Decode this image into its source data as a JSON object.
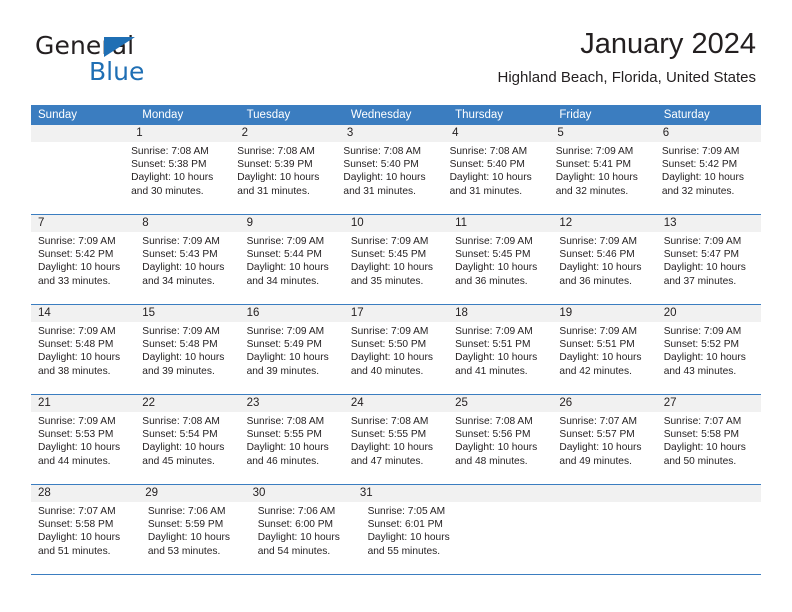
{
  "brand": {
    "name_part1": "General",
    "name_part2": "Blue",
    "accent_color": "#1f6fb4"
  },
  "header": {
    "title": "January 2024",
    "subtitle": "Highland Beach, Florida, United States",
    "header_bg_color": "#3b7dc0",
    "daynum_bg_color": "#f1f1f1"
  },
  "weekdays": [
    "Sunday",
    "Monday",
    "Tuesday",
    "Wednesday",
    "Thursday",
    "Friday",
    "Saturday"
  ],
  "weeks": [
    {
      "days": [
        {
          "num": "",
          "sunrise": "",
          "sunset": "",
          "daylight_line1": "",
          "daylight_line2": "",
          "empty": true
        },
        {
          "num": "1",
          "sunrise": "Sunrise: 7:08 AM",
          "sunset": "Sunset: 5:38 PM",
          "daylight_line1": "Daylight: 10 hours",
          "daylight_line2": "and 30 minutes.",
          "empty": false
        },
        {
          "num": "2",
          "sunrise": "Sunrise: 7:08 AM",
          "sunset": "Sunset: 5:39 PM",
          "daylight_line1": "Daylight: 10 hours",
          "daylight_line2": "and 31 minutes.",
          "empty": false
        },
        {
          "num": "3",
          "sunrise": "Sunrise: 7:08 AM",
          "sunset": "Sunset: 5:40 PM",
          "daylight_line1": "Daylight: 10 hours",
          "daylight_line2": "and 31 minutes.",
          "empty": false
        },
        {
          "num": "4",
          "sunrise": "Sunrise: 7:08 AM",
          "sunset": "Sunset: 5:40 PM",
          "daylight_line1": "Daylight: 10 hours",
          "daylight_line2": "and 31 minutes.",
          "empty": false
        },
        {
          "num": "5",
          "sunrise": "Sunrise: 7:09 AM",
          "sunset": "Sunset: 5:41 PM",
          "daylight_line1": "Daylight: 10 hours",
          "daylight_line2": "and 32 minutes.",
          "empty": false
        },
        {
          "num": "6",
          "sunrise": "Sunrise: 7:09 AM",
          "sunset": "Sunset: 5:42 PM",
          "daylight_line1": "Daylight: 10 hours",
          "daylight_line2": "and 32 minutes.",
          "empty": false
        }
      ]
    },
    {
      "days": [
        {
          "num": "7",
          "sunrise": "Sunrise: 7:09 AM",
          "sunset": "Sunset: 5:42 PM",
          "daylight_line1": "Daylight: 10 hours",
          "daylight_line2": "and 33 minutes.",
          "empty": false
        },
        {
          "num": "8",
          "sunrise": "Sunrise: 7:09 AM",
          "sunset": "Sunset: 5:43 PM",
          "daylight_line1": "Daylight: 10 hours",
          "daylight_line2": "and 34 minutes.",
          "empty": false
        },
        {
          "num": "9",
          "sunrise": "Sunrise: 7:09 AM",
          "sunset": "Sunset: 5:44 PM",
          "daylight_line1": "Daylight: 10 hours",
          "daylight_line2": "and 34 minutes.",
          "empty": false
        },
        {
          "num": "10",
          "sunrise": "Sunrise: 7:09 AM",
          "sunset": "Sunset: 5:45 PM",
          "daylight_line1": "Daylight: 10 hours",
          "daylight_line2": "and 35 minutes.",
          "empty": false
        },
        {
          "num": "11",
          "sunrise": "Sunrise: 7:09 AM",
          "sunset": "Sunset: 5:45 PM",
          "daylight_line1": "Daylight: 10 hours",
          "daylight_line2": "and 36 minutes.",
          "empty": false
        },
        {
          "num": "12",
          "sunrise": "Sunrise: 7:09 AM",
          "sunset": "Sunset: 5:46 PM",
          "daylight_line1": "Daylight: 10 hours",
          "daylight_line2": "and 36 minutes.",
          "empty": false
        },
        {
          "num": "13",
          "sunrise": "Sunrise: 7:09 AM",
          "sunset": "Sunset: 5:47 PM",
          "daylight_line1": "Daylight: 10 hours",
          "daylight_line2": "and 37 minutes.",
          "empty": false
        }
      ]
    },
    {
      "days": [
        {
          "num": "14",
          "sunrise": "Sunrise: 7:09 AM",
          "sunset": "Sunset: 5:48 PM",
          "daylight_line1": "Daylight: 10 hours",
          "daylight_line2": "and 38 minutes.",
          "empty": false
        },
        {
          "num": "15",
          "sunrise": "Sunrise: 7:09 AM",
          "sunset": "Sunset: 5:48 PM",
          "daylight_line1": "Daylight: 10 hours",
          "daylight_line2": "and 39 minutes.",
          "empty": false
        },
        {
          "num": "16",
          "sunrise": "Sunrise: 7:09 AM",
          "sunset": "Sunset: 5:49 PM",
          "daylight_line1": "Daylight: 10 hours",
          "daylight_line2": "and 39 minutes.",
          "empty": false
        },
        {
          "num": "17",
          "sunrise": "Sunrise: 7:09 AM",
          "sunset": "Sunset: 5:50 PM",
          "daylight_line1": "Daylight: 10 hours",
          "daylight_line2": "and 40 minutes.",
          "empty": false
        },
        {
          "num": "18",
          "sunrise": "Sunrise: 7:09 AM",
          "sunset": "Sunset: 5:51 PM",
          "daylight_line1": "Daylight: 10 hours",
          "daylight_line2": "and 41 minutes.",
          "empty": false
        },
        {
          "num": "19",
          "sunrise": "Sunrise: 7:09 AM",
          "sunset": "Sunset: 5:51 PM",
          "daylight_line1": "Daylight: 10 hours",
          "daylight_line2": "and 42 minutes.",
          "empty": false
        },
        {
          "num": "20",
          "sunrise": "Sunrise: 7:09 AM",
          "sunset": "Sunset: 5:52 PM",
          "daylight_line1": "Daylight: 10 hours",
          "daylight_line2": "and 43 minutes.",
          "empty": false
        }
      ]
    },
    {
      "days": [
        {
          "num": "21",
          "sunrise": "Sunrise: 7:09 AM",
          "sunset": "Sunset: 5:53 PM",
          "daylight_line1": "Daylight: 10 hours",
          "daylight_line2": "and 44 minutes.",
          "empty": false
        },
        {
          "num": "22",
          "sunrise": "Sunrise: 7:08 AM",
          "sunset": "Sunset: 5:54 PM",
          "daylight_line1": "Daylight: 10 hours",
          "daylight_line2": "and 45 minutes.",
          "empty": false
        },
        {
          "num": "23",
          "sunrise": "Sunrise: 7:08 AM",
          "sunset": "Sunset: 5:55 PM",
          "daylight_line1": "Daylight: 10 hours",
          "daylight_line2": "and 46 minutes.",
          "empty": false
        },
        {
          "num": "24",
          "sunrise": "Sunrise: 7:08 AM",
          "sunset": "Sunset: 5:55 PM",
          "daylight_line1": "Daylight: 10 hours",
          "daylight_line2": "and 47 minutes.",
          "empty": false
        },
        {
          "num": "25",
          "sunrise": "Sunrise: 7:08 AM",
          "sunset": "Sunset: 5:56 PM",
          "daylight_line1": "Daylight: 10 hours",
          "daylight_line2": "and 48 minutes.",
          "empty": false
        },
        {
          "num": "26",
          "sunrise": "Sunrise: 7:07 AM",
          "sunset": "Sunset: 5:57 PM",
          "daylight_line1": "Daylight: 10 hours",
          "daylight_line2": "and 49 minutes.",
          "empty": false
        },
        {
          "num": "27",
          "sunrise": "Sunrise: 7:07 AM",
          "sunset": "Sunset: 5:58 PM",
          "daylight_line1": "Daylight: 10 hours",
          "daylight_line2": "and 50 minutes.",
          "empty": false
        }
      ]
    },
    {
      "days": [
        {
          "num": "28",
          "sunrise": "Sunrise: 7:07 AM",
          "sunset": "Sunset: 5:58 PM",
          "daylight_line1": "Daylight: 10 hours",
          "daylight_line2": "and 51 minutes.",
          "empty": false
        },
        {
          "num": "29",
          "sunrise": "Sunrise: 7:06 AM",
          "sunset": "Sunset: 5:59 PM",
          "daylight_line1": "Daylight: 10 hours",
          "daylight_line2": "and 53 minutes.",
          "empty": false
        },
        {
          "num": "30",
          "sunrise": "Sunrise: 7:06 AM",
          "sunset": "Sunset: 6:00 PM",
          "daylight_line1": "Daylight: 10 hours",
          "daylight_line2": "and 54 minutes.",
          "empty": false
        },
        {
          "num": "31",
          "sunrise": "Sunrise: 7:05 AM",
          "sunset": "Sunset: 6:01 PM",
          "daylight_line1": "Daylight: 10 hours",
          "daylight_line2": "and 55 minutes.",
          "empty": false
        },
        {
          "num": "",
          "sunrise": "",
          "sunset": "",
          "daylight_line1": "",
          "daylight_line2": "",
          "empty": true
        },
        {
          "num": "",
          "sunrise": "",
          "sunset": "",
          "daylight_line1": "",
          "daylight_line2": "",
          "empty": true
        },
        {
          "num": "",
          "sunrise": "",
          "sunset": "",
          "daylight_line1": "",
          "daylight_line2": "",
          "empty": true
        }
      ]
    }
  ]
}
